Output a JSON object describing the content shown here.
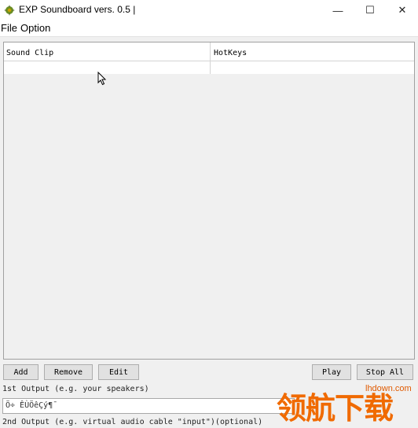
{
  "window": {
    "title": "EXP Soundboard vers. 0.5 |",
    "minimize_glyph": "—",
    "maximize_glyph": "☐",
    "close_glyph": "✕"
  },
  "menu": [
    {
      "label": "File"
    },
    {
      "label": "Option"
    }
  ],
  "table": {
    "columns": [
      "Sound Clip",
      "HotKeys"
    ],
    "rows": []
  },
  "buttons": {
    "add": "Add",
    "remove": "Remove",
    "edit": "Edit",
    "play": "Play",
    "stop_all": "Stop All"
  },
  "outputs": {
    "first_label": "1st Output (e.g. your speakers)",
    "first_value": "Ö÷ ÊÙÖêÇý¶¯",
    "second_label": "2nd Output (e.g. virtual audio cable \"input\")(optional)"
  },
  "watermark": {
    "url": "lhdown.com",
    "logo_text": "领航下载"
  }
}
